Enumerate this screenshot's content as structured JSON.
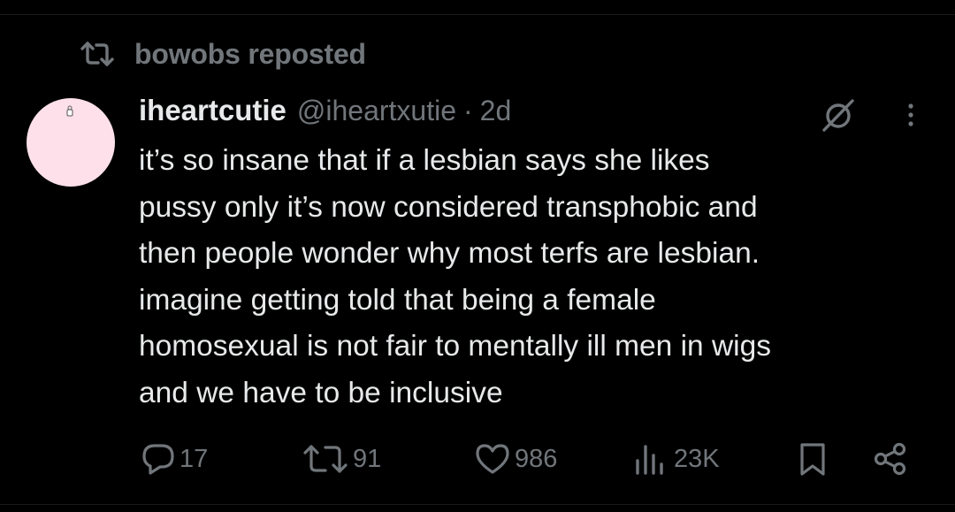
{
  "repost": {
    "label": "bowobs reposted",
    "icon": "repost-icon"
  },
  "tweet": {
    "display_name": "iheartcutie",
    "handle": "@iheartxutie",
    "separator": "·",
    "timestamp": "2d",
    "avatar_color": "#fde0ea",
    "text": "it’s so insane that if a lesbian says she likes\npussy only it’s now considered transphobic and\nthen people wonder why most terfs are lesbian.\nimagine getting told that being a female\nhomosexual is not fair to mentally ill men in wigs\nand we have to be inclusive"
  },
  "actions": {
    "replies": "17",
    "reposts": "91",
    "likes": "986",
    "views": "23K"
  },
  "icons": [
    "repost-icon",
    "grok-icon",
    "more-icon",
    "reply-icon",
    "like-icon",
    "views-icon",
    "bookmark-icon",
    "share-icon"
  ],
  "colors": {
    "background": "#000000",
    "text_primary": "#e7e9ea",
    "text_secondary": "#71767b"
  }
}
